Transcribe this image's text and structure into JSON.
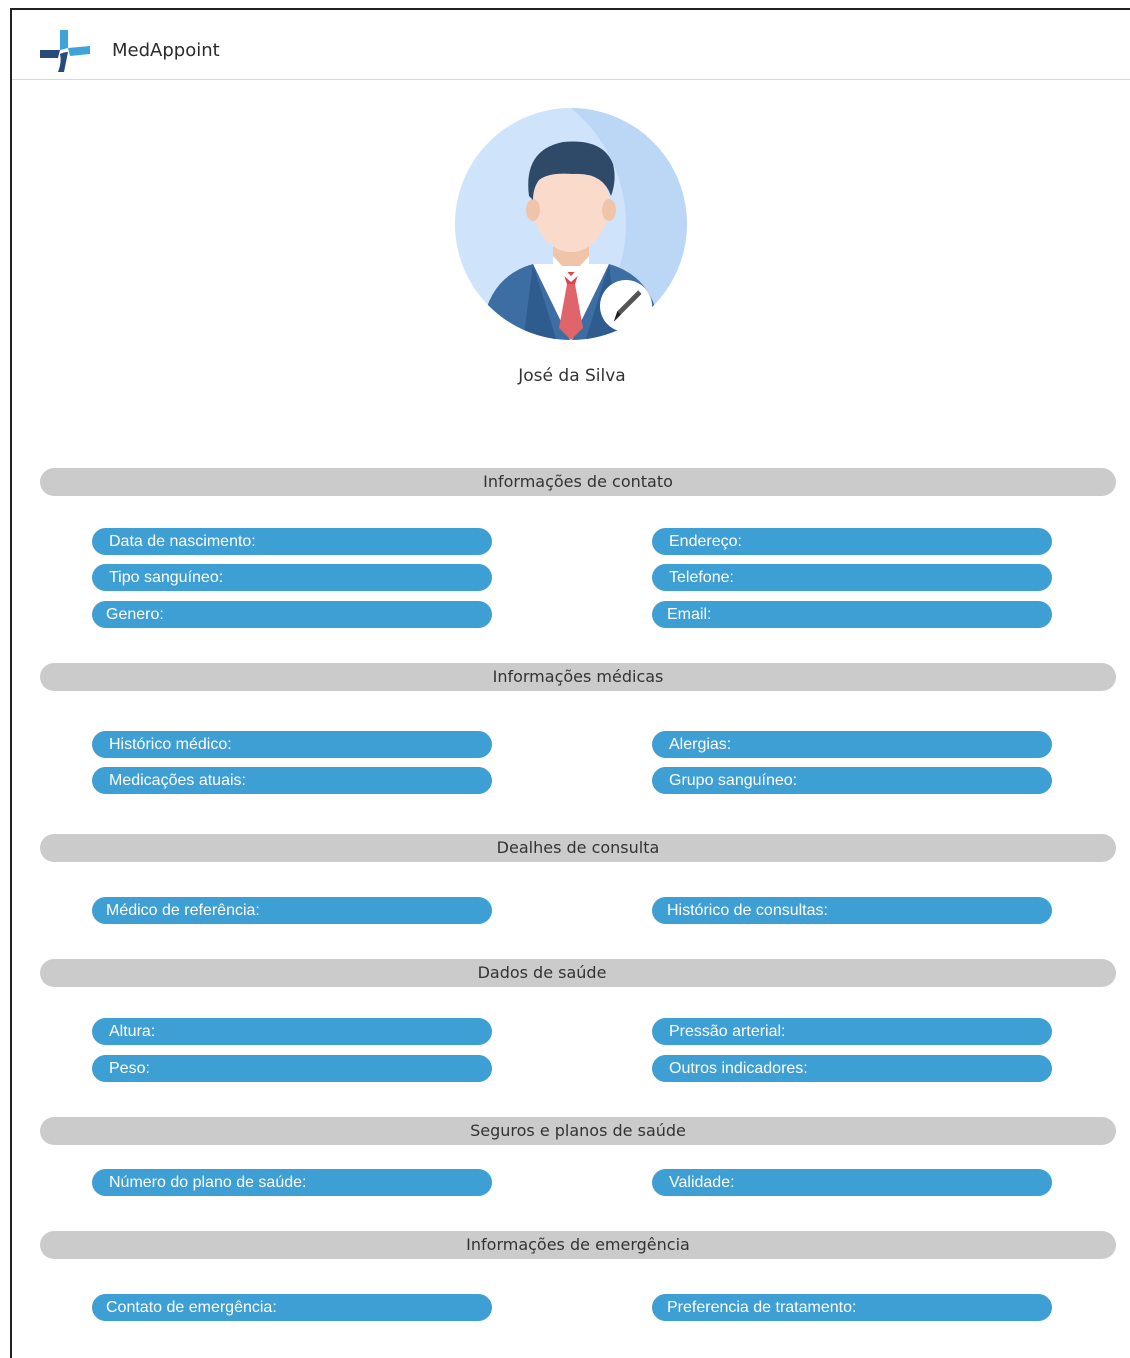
{
  "app": {
    "brand": "MedAppoint"
  },
  "profile": {
    "name": "José da Silva"
  },
  "sections": [
    {
      "title": "Informações de contato",
      "left": [
        "Data de nascimento:",
        "Tipo sanguíneo:",
        "Genero:"
      ],
      "right": [
        "Endereço:",
        "Telefone:",
        "Email:"
      ]
    },
    {
      "title": "Informações médicas",
      "left": [
        "Histórico médico:",
        "Medicações atuais:"
      ],
      "right": [
        "Alergias:",
        "Grupo sanguíneo:"
      ]
    },
    {
      "title": "Dealhes de consulta",
      "left": [
        "Médico de referência:"
      ],
      "right": [
        "Histórico de consultas:"
      ]
    },
    {
      "title": "Dados de saúde",
      "left": [
        "Altura:",
        "Peso:"
      ],
      "right": [
        "Pressão arterial:",
        "Outros indicadores:"
      ]
    },
    {
      "title": "Seguros e planos de saúde",
      "left": [
        "Número do plano de saúde:"
      ],
      "right": [
        "Validade:"
      ]
    },
    {
      "title": "Informações de emergência",
      "left": [
        "Contato de emergência:"
      ],
      "right": [
        "Preferencia de tratamento:"
      ]
    }
  ],
  "colors": {
    "field_blue": "#3d9fd3",
    "section_gray": "#cbcbcb",
    "avatar_bg": "#cfe3fb",
    "logo_dark": "#274a7a",
    "logo_light": "#3fa2d8"
  },
  "icons": {
    "logo": "medical-cross-logo-icon",
    "avatar": "businessman-avatar-icon",
    "edit": "pencil-edit-icon"
  }
}
